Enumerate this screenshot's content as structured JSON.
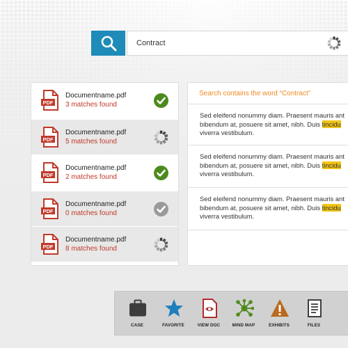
{
  "search": {
    "query": "Contract"
  },
  "results": [
    {
      "name": "Documentname.pdf",
      "matches": "3 matches found",
      "status": "done"
    },
    {
      "name": "Documentname.pdf",
      "matches": "5 matches found",
      "status": "loading"
    },
    {
      "name": "Documentname.pdf",
      "matches": "2 matches found",
      "status": "done"
    },
    {
      "name": "Documentname.pdf",
      "matches": "0 matches found",
      "status": "done-grey"
    },
    {
      "name": "Documentname.pdf",
      "matches": "8 matches found",
      "status": "loading"
    }
  ],
  "preview": {
    "title": "Search contains the word “Contract”",
    "snippets": [
      {
        "line1": "Sed eleifend nonummy diam. Praesent mauris ant",
        "line2a": "bibendum at, posuere sit amet, nibh. Duis ",
        "highlight": "tincidu",
        "line3": "viverra vestibulum."
      },
      {
        "line1": "Sed eleifend nonummy diam. Praesent mauris ant",
        "line2a": "bibendum at, posuere sit amet, nibh. Duis ",
        "highlight": "tincidu",
        "line3": "viverra vestibulum."
      },
      {
        "line1": "Sed eleifend nonummy diam. Praesent mauris ant",
        "line2a": "bibendum at, posuere sit amet, nibh. Duis ",
        "highlight": "tincidu",
        "line3": "viverra vestibulum."
      }
    ]
  },
  "toolbar": {
    "case": "CASE",
    "favorite": "FAVORITE",
    "view_doc": "VIEW DOC",
    "mind_map": "MIND MAP",
    "exhibits": "EXHIBITS",
    "files": "FILES"
  },
  "colors": {
    "accent_blue": "#1e8bb8",
    "pdf_red": "#c0392b",
    "check_green": "#4c8a1e",
    "title_orange": "#f08a24",
    "highlight_yellow": "#f3c515"
  },
  "icons": [
    "search-icon",
    "spinner-icon",
    "pdf-icon",
    "check-icon",
    "briefcase-icon",
    "star-icon",
    "view-doc-icon",
    "mind-map-icon",
    "warning-icon",
    "files-icon"
  ]
}
